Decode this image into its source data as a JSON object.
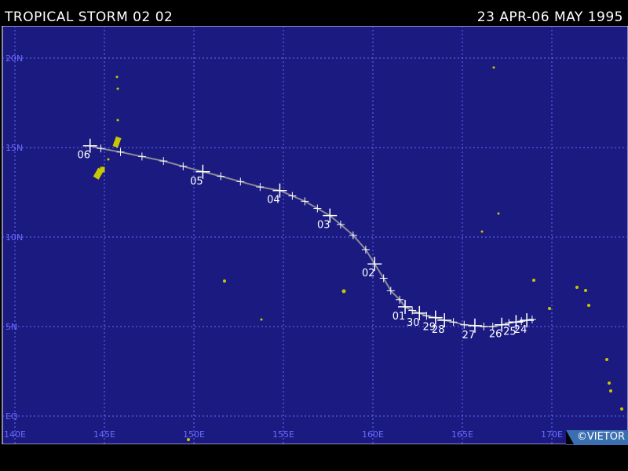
{
  "header": {
    "storm_name": "TROPICAL STORM 02 02",
    "date_range": "23 APR-06 MAY 1995"
  },
  "credit": "©VIETOR",
  "colors": {
    "ocean": "#1a1a80",
    "grid": "#6a6aff",
    "track": "#8a8a9a",
    "marker": "#ffffff",
    "land": "#c8c800",
    "label": "#ffffff",
    "axis_label": "#6a6aff"
  },
  "axes": {
    "lon_min": 140,
    "lon_max": 172,
    "lat_min": 0,
    "lat_max": 21,
    "lon_ticks": [
      {
        "value": 140,
        "label": "140E"
      },
      {
        "value": 145,
        "label": "145E"
      },
      {
        "value": 150,
        "label": "150E"
      },
      {
        "value": 155,
        "label": "155E"
      },
      {
        "value": 160,
        "label": "160E"
      },
      {
        "value": 165,
        "label": "165E"
      },
      {
        "value": 170,
        "label": "170E"
      }
    ],
    "lat_ticks": [
      {
        "value": 0,
        "label": "EQ"
      },
      {
        "value": 5,
        "label": "5N"
      },
      {
        "value": 10,
        "label": "10N"
      },
      {
        "value": 15,
        "label": "15N"
      },
      {
        "value": 20,
        "label": "20N"
      }
    ]
  },
  "track": [
    {
      "lon": 168.9,
      "lat": 5.4
    },
    {
      "lon": 168.6,
      "lat": 5.35
    },
    {
      "lon": 168.3,
      "lat": 5.3
    },
    {
      "lon": 168.0,
      "lat": 5.25
    },
    {
      "lon": 167.6,
      "lat": 5.2
    },
    {
      "lon": 167.2,
      "lat": 5.1
    },
    {
      "lon": 166.7,
      "lat": 5.0
    },
    {
      "lon": 166.2,
      "lat": 5.0
    },
    {
      "lon": 165.7,
      "lat": 5.05
    },
    {
      "lon": 165.1,
      "lat": 5.1
    },
    {
      "lon": 164.5,
      "lat": 5.25
    },
    {
      "lon": 164.0,
      "lat": 5.35
    },
    {
      "lon": 163.5,
      "lat": 5.5
    },
    {
      "lon": 163.0,
      "lat": 5.6
    },
    {
      "lon": 162.6,
      "lat": 5.75
    },
    {
      "lon": 162.2,
      "lat": 5.9
    },
    {
      "lon": 161.8,
      "lat": 6.1
    },
    {
      "lon": 161.5,
      "lat": 6.5
    },
    {
      "lon": 161.0,
      "lat": 7.0
    },
    {
      "lon": 160.6,
      "lat": 7.7
    },
    {
      "lon": 160.1,
      "lat": 8.5
    },
    {
      "lon": 159.6,
      "lat": 9.3
    },
    {
      "lon": 158.9,
      "lat": 10.1
    },
    {
      "lon": 158.2,
      "lat": 10.7
    },
    {
      "lon": 157.6,
      "lat": 11.2
    },
    {
      "lon": 156.9,
      "lat": 11.6
    },
    {
      "lon": 156.2,
      "lat": 12.0
    },
    {
      "lon": 155.5,
      "lat": 12.3
    },
    {
      "lon": 154.8,
      "lat": 12.6
    },
    {
      "lon": 153.7,
      "lat": 12.8
    },
    {
      "lon": 152.6,
      "lat": 13.1
    },
    {
      "lon": 151.5,
      "lat": 13.4
    },
    {
      "lon": 150.5,
      "lat": 13.65
    },
    {
      "lon": 149.4,
      "lat": 13.95
    },
    {
      "lon": 148.3,
      "lat": 14.25
    },
    {
      "lon": 147.1,
      "lat": 14.5
    },
    {
      "lon": 145.9,
      "lat": 14.75
    },
    {
      "lon": 144.8,
      "lat": 14.95
    },
    {
      "lon": 144.2,
      "lat": 15.1
    }
  ],
  "day_markers": [
    {
      "label": "06",
      "lon": 144.2,
      "lat": 15.1
    },
    {
      "label": "05",
      "lon": 150.5,
      "lat": 13.65
    },
    {
      "label": "04",
      "lon": 154.8,
      "lat": 12.6
    },
    {
      "label": "03",
      "lon": 157.6,
      "lat": 11.2
    },
    {
      "label": "02",
      "lon": 160.1,
      "lat": 8.5
    },
    {
      "label": "01",
      "lon": 161.8,
      "lat": 6.1
    },
    {
      "label": "30",
      "lon": 162.6,
      "lat": 5.75
    },
    {
      "label": "29",
      "lon": 163.5,
      "lat": 5.5
    },
    {
      "label": "28",
      "lon": 164.0,
      "lat": 5.35
    },
    {
      "label": "27",
      "lon": 165.7,
      "lat": 5.05
    },
    {
      "label": "26",
      "lon": 167.2,
      "lat": 5.1
    },
    {
      "label": "25",
      "lon": 168.0,
      "lat": 5.25
    },
    {
      "label": "24",
      "lon": 168.6,
      "lat": 5.35
    }
  ]
}
